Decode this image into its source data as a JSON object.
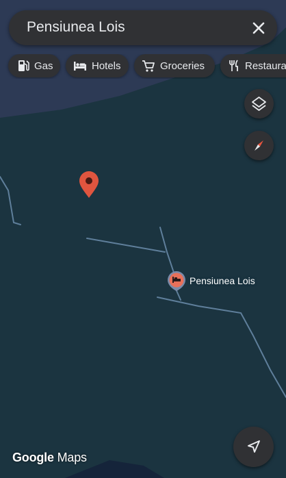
{
  "search": {
    "query": "Pensiunea Lois"
  },
  "chips": [
    {
      "label": "Gas",
      "icon": "gas-station-icon"
    },
    {
      "label": "Hotels",
      "icon": "bed-icon"
    },
    {
      "label": "Groceries",
      "icon": "cart-icon"
    },
    {
      "label": "Restaurants",
      "icon": "fork-knife-icon"
    }
  ],
  "map": {
    "place_label": "Pensiunea Lois",
    "place_icon": "hotel-bed-icon",
    "dropped_pin_icon": "map-pin-icon"
  },
  "controls": {
    "layers_icon": "layers-icon",
    "compass_icon": "compass-icon",
    "navigate_icon": "navigation-arrow-icon"
  },
  "branding": {
    "google": "Google",
    "maps": "Maps"
  },
  "colors": {
    "map_background": "#1b3440",
    "surface": "#303134",
    "text": "#e8eaed",
    "road": "#5f7f9b",
    "pin_red": "#e0553f",
    "hotel_marker": "#e8705a"
  }
}
